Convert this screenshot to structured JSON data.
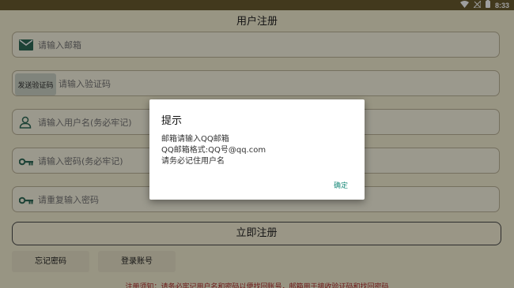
{
  "statusbar": {
    "time": "8:33"
  },
  "app": {
    "title": "用户注册",
    "fields": {
      "email": {
        "placeholder": "请输入邮箱"
      },
      "code": {
        "button": "发送验证码",
        "placeholder": "请输入验证码"
      },
      "username": {
        "placeholder": "请输入用户名(务必牢记)"
      },
      "password": {
        "placeholder": "请输入密码(务必牢记)"
      },
      "confirm": {
        "placeholder": "请重复输入密码"
      }
    },
    "register_label": "立即注册",
    "forgot_label": "忘记密码",
    "login_label": "登录账号",
    "footnote": "注册须知：请务必牢记用户名和密码以便找回账号，邮箱用于接收验证码和找回密码"
  },
  "dialog": {
    "title": "提示",
    "lines": [
      "邮箱请输入QQ邮箱",
      "QQ邮箱格式:QQ号@qq.com",
      "请务必记住用户名"
    ],
    "ok": "确定"
  },
  "colors": {
    "accent": "#1a8a7a",
    "icon": "#2f6b57",
    "footnote": "#b12a2a"
  }
}
